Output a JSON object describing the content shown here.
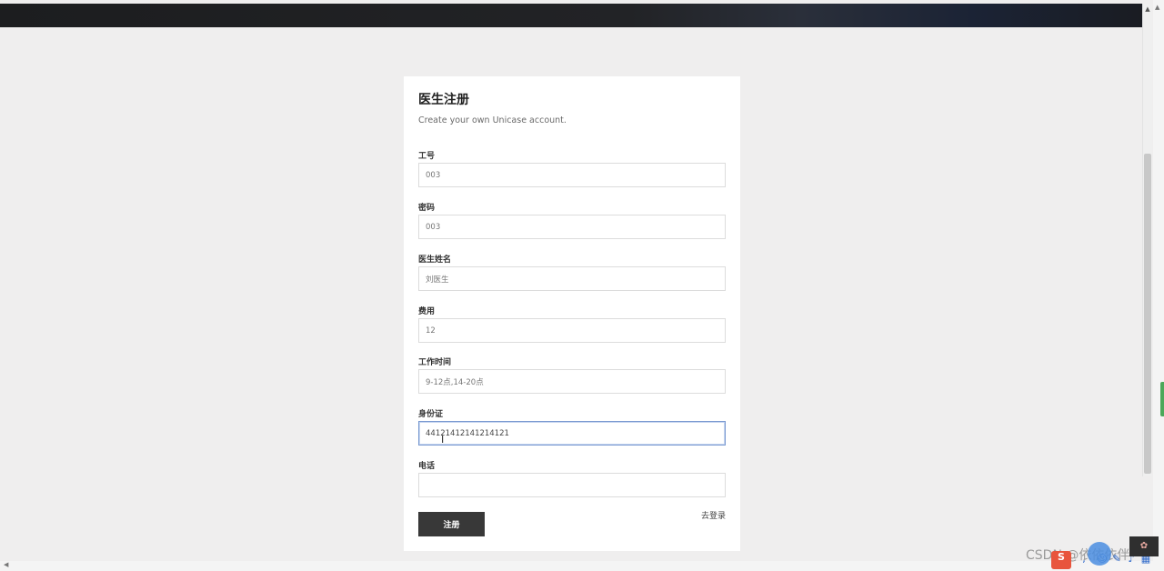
{
  "form": {
    "title": "医生注册",
    "subtitle": "Create your own Unicase account.",
    "fields": [
      {
        "label": "工号",
        "value": "003"
      },
      {
        "label": "密码",
        "value": "003"
      },
      {
        "label": "医生姓名",
        "value": "刘医生"
      },
      {
        "label": "费用",
        "value": "12"
      },
      {
        "label": "工作时间",
        "value": "9-12点,14-20点"
      },
      {
        "label": "身份证",
        "value": "44121412141214121"
      },
      {
        "label": "电话",
        "value": ""
      }
    ],
    "submit_label": "注册",
    "login_link": "去登录"
  },
  "watermark": "CSDN @依依依伴",
  "icons": {
    "text_cursor": "I-beam-cursor-icon",
    "tray": [
      "sogou-ime-icon",
      "punctuation-icon",
      "emoji-icon",
      "pen-icon",
      "mic-icon",
      "grid-icon"
    ]
  },
  "colors": {
    "page_bg": "#efeeee",
    "card_bg": "#ffffff",
    "button_bg": "#383838",
    "focus_border": "#7a9ad1"
  }
}
